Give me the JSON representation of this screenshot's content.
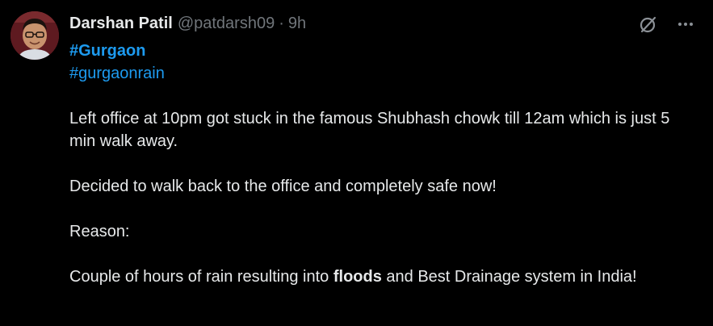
{
  "author": {
    "display_name": "Darshan Patil",
    "handle": "@patdarsh09",
    "separator": "·",
    "time": "9h"
  },
  "icons": {
    "avatar": "avatar-photo",
    "grok": "grok-icon",
    "more": "more-options-icon"
  },
  "tweet": {
    "hashtag_1": "#Gurgaon",
    "hashtag_2": "#gurgaonrain",
    "paragraph_1": "Left office at 10pm got stuck in the famous Shubhash chowk till 12am which is just 5 min walk away.",
    "paragraph_2": "Decided to walk back to the office and completely safe now!",
    "paragraph_3": "Reason:",
    "paragraph_4_before": "Couple of hours of rain resulting into ",
    "paragraph_4_bold": "floods",
    "paragraph_4_after": " and Best Drainage system in India!"
  },
  "colors": {
    "background": "#000000",
    "text": "#e7e9ea",
    "secondary": "#71767b",
    "link": "#1d9bf0"
  }
}
